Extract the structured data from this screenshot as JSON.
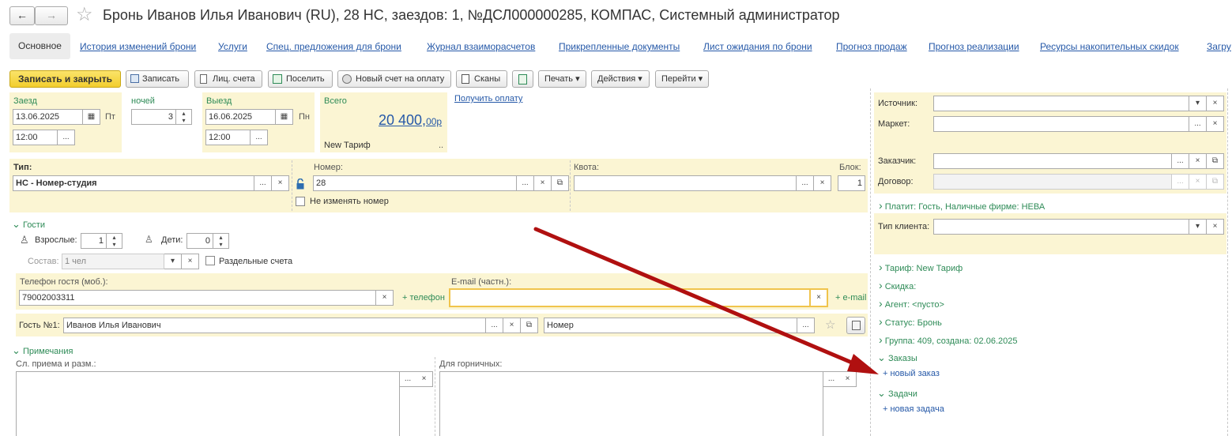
{
  "window": {
    "title": "Бронь Иванов Илья Иванович (RU), 28 НС, заездов: 1, №ДСЛ000000285, КОМПАС, Системный администратор"
  },
  "nav": {
    "back": "←",
    "forward": "→",
    "star": "☆"
  },
  "tabs": [
    "Основное",
    "История изменений брони",
    "Услуги",
    "Спец. предложения для брони",
    "Журнал взаиморасчетов",
    "Прикрепленные документы",
    "Лист ожидания по брони",
    "Прогноз продаж",
    "Прогноз реализации",
    "Ресурсы накопительных скидок",
    "Загру"
  ],
  "toolbar": {
    "save_close": "Записать и закрыть",
    "save": "Записать",
    "account": "Лиц. счета",
    "checkin": "Поселить",
    "new_invoice": "Новый счет на оплату",
    "scans": "Сканы",
    "print": "Печать",
    "actions": "Действия",
    "goto": "Перейти",
    "dropdown": "▾"
  },
  "dates": {
    "checkin_label": "Заезд",
    "checkin_date": "13.06.2025",
    "checkin_dow": "Пт",
    "checkin_time": "12:00",
    "nights_label": "ночей",
    "nights": "3",
    "checkout_label": "Выезд",
    "checkout_date": "16.06.2025",
    "checkout_dow": "Пн",
    "checkout_time": "12:00"
  },
  "total": {
    "label": "Всего",
    "amount": "20 400,",
    "cents": "00р",
    "tariff": "New Тариф",
    "dots": "..",
    "get_payment": "Получить оплату"
  },
  "room": {
    "type_label": "Тип:",
    "type_value": "НС - Номер-студия",
    "number_label": "Номер:",
    "number_value": "28",
    "no_change": "Не изменять номер",
    "quota_label": "Квота:",
    "quota_value": "",
    "block_label": "Блок:",
    "block_value": "1"
  },
  "guests": {
    "section": "Гости",
    "adults_label": "Взрослые:",
    "adults": "1",
    "children_label": "Дети:",
    "children": "0",
    "composition_label": "Состав:",
    "composition_value": "1 чел",
    "separate_accounts": "Раздельные счета",
    "phone_label": "Телефон гостя (моб.):",
    "phone": "79002003311",
    "add_phone": "+ телефон",
    "email_label": "E-mail (частн.):",
    "email": "",
    "add_email": "+ e-mail",
    "guest1_label": "Гость №1:",
    "guest1_name": "Иванов Илья Иванович",
    "guest1_role": "Номер"
  },
  "notes": {
    "section": "Примечания",
    "reception_label": "Сл. приема и разм.:",
    "housekeeping_label": "Для горничных:"
  },
  "right": {
    "source_label": "Источник:",
    "market_label": "Маркет:",
    "customer_label": "Заказчик:",
    "contract_label": "Договор:",
    "payer": "Платит: Гость, Наличные фирме: НЕВА",
    "client_type_label": "Тип клиента:",
    "tariff": "Тариф: New Тариф",
    "discount": "Скидка:",
    "agent": "Агент: <пусто>",
    "status": "Статус: Бронь",
    "group": "Группа: 409, создана: 02.06.2025",
    "orders": "Заказы",
    "new_order": "+ новый заказ",
    "tasks": "Задачи",
    "new_task": "+ новая задача"
  },
  "glyphs": {
    "dots": "...",
    "clear": "×",
    "drop": "▾",
    "copy": "⧉",
    "spin_up": "▴",
    "spin_down": "▾",
    "chev_right": "›",
    "chev_down": "⌄"
  },
  "colors": {
    "accent_yellow": "#f5d84a",
    "field_bg": "#fbf5d3",
    "link": "#2659a8",
    "section_green": "#2e8b57",
    "arrow_red": "#b01010"
  }
}
